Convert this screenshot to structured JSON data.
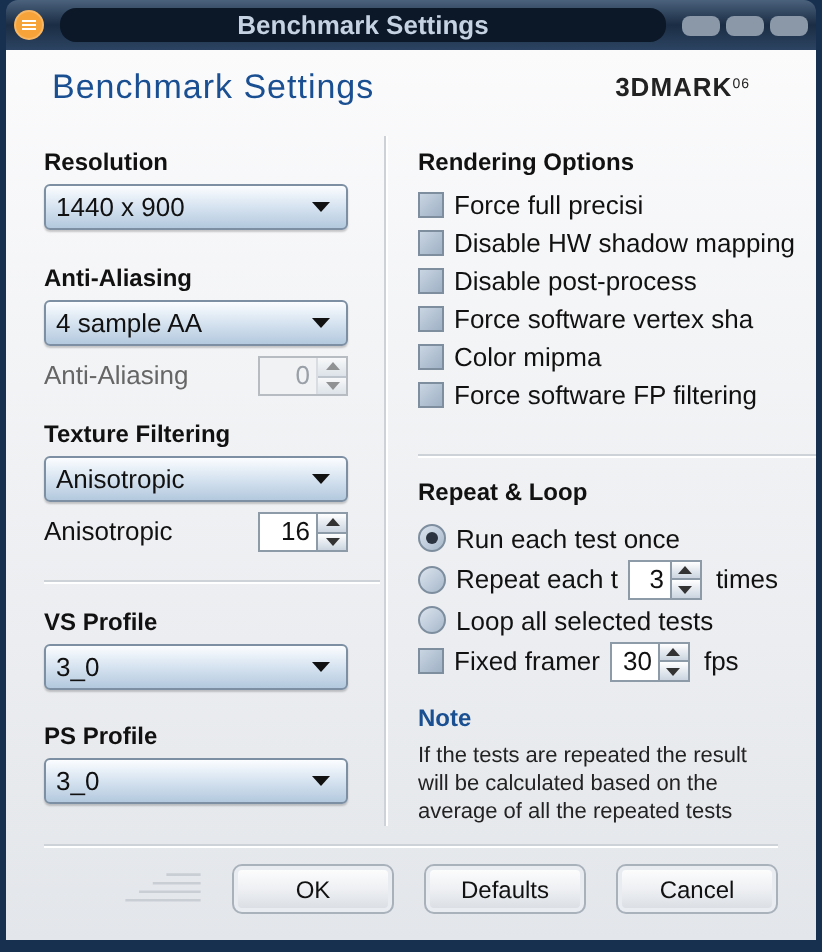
{
  "window": {
    "title": "Benchmark Settings"
  },
  "header": {
    "title": "Benchmark Settings",
    "logo": "3DMARK",
    "logo_suffix": "06"
  },
  "left": {
    "resolution": {
      "label": "Resolution",
      "value": "1440 x 900"
    },
    "anti_aliasing": {
      "label": "Anti-Aliasing",
      "value": "4 sample AA"
    },
    "aa_quality": {
      "label": "Anti-Aliasing",
      "value": "0",
      "disabled": true
    },
    "texture_filtering": {
      "label": "Texture Filtering",
      "value": "Anisotropic"
    },
    "anisotropic": {
      "label": "Anisotropic",
      "value": "16",
      "disabled": false
    },
    "vs_profile": {
      "label": "VS Profile",
      "value": "3_0"
    },
    "ps_profile": {
      "label": "PS Profile",
      "value": "3_0"
    }
  },
  "rendering_options": {
    "title": "Rendering Options",
    "items": [
      {
        "label": "Force full precisi",
        "checked": false
      },
      {
        "label": "Disable HW shadow mapping",
        "checked": false
      },
      {
        "label": "Disable post-process",
        "checked": false
      },
      {
        "label": "Force software vertex sha",
        "checked": false
      },
      {
        "label": "Color mipma",
        "checked": false
      },
      {
        "label": "Force software FP filtering",
        "checked": false
      }
    ]
  },
  "repeat_loop": {
    "title": "Repeat & Loop",
    "items": [
      {
        "kind": "radio",
        "label": "Run each test once",
        "selected": true
      },
      {
        "kind": "radio",
        "label": "Repeat each t",
        "selected": false,
        "value": "3",
        "unit": "times"
      },
      {
        "kind": "radio",
        "label": "Loop all selected tests",
        "selected": false
      },
      {
        "kind": "checkbox",
        "label": "Fixed framer",
        "checked": false,
        "value": "30",
        "unit": "fps"
      }
    ]
  },
  "note": {
    "title": "Note",
    "text": "If the tests are repeated the result will be calculated based on the average of all the repeated tests"
  },
  "buttons": [
    "OK",
    "Defaults",
    "Cancel"
  ]
}
